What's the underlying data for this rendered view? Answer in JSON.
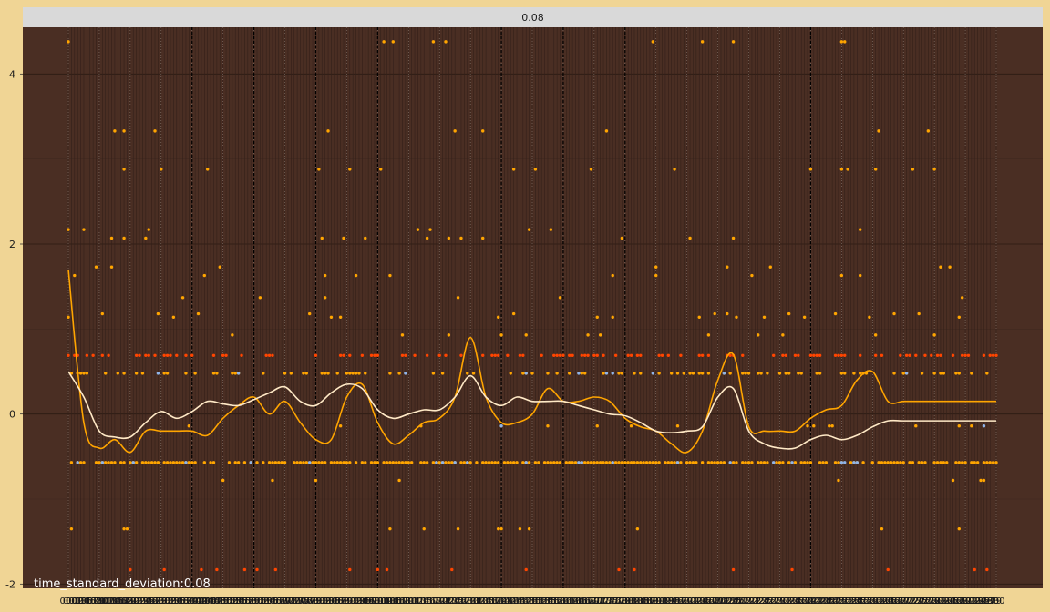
{
  "panel": {
    "strip_label": "0.08"
  },
  "caption": {
    "prefix": "time_standard_deviation:",
    "value": "0.08"
  },
  "colors": {
    "background": "#f0d595",
    "panel_bg": "#4a2e23",
    "strip_bg": "#d9d9d9",
    "points_orange": "#ffa500",
    "points_red": "#ff4500",
    "points_blue": "#8fb4e8",
    "smooth_orange": "#ffa500",
    "smooth_cream": "#ffe9c6"
  },
  "chart_data": {
    "type": "scatter",
    "title": "0.08",
    "xlabel": "",
    "ylabel": "",
    "xlim": [
      0,
      300
    ],
    "ylim": [
      -2.05,
      4.55
    ],
    "yticks": [
      -2,
      0,
      2,
      4
    ],
    "x_tick_count": 300,
    "major_vlines_x": [
      40,
      60,
      80,
      100,
      140,
      160,
      180,
      240
    ],
    "grid": true,
    "series": [
      {
        "color": "#ffa500",
        "level_values": [
          4.38,
          3.33,
          2.88,
          2.17,
          2.07,
          1.73,
          1.63,
          1.37,
          1.18,
          1.14,
          0.93,
          0.48,
          -0.14,
          -0.57,
          -0.78,
          -1.35
        ]
      },
      {
        "color": "#ff4500",
        "level_values": [
          0.69,
          -1.83
        ]
      },
      {
        "color": "#8fb4e8",
        "level_values": [
          0.48,
          -0.14,
          -0.57
        ]
      }
    ],
    "smooth_lines": [
      {
        "color": "#ffa500",
        "x": [
          0,
          5,
          10,
          15,
          20,
          25,
          30,
          35,
          40,
          45,
          50,
          55,
          60,
          65,
          70,
          75,
          80,
          85,
          90,
          95,
          100,
          105,
          110,
          115,
          120,
          125,
          130,
          135,
          140,
          145,
          150,
          155,
          160,
          165,
          170,
          175,
          180,
          185,
          190,
          195,
          200,
          205,
          210,
          215,
          220,
          225,
          230,
          235,
          240,
          245,
          250,
          255,
          260,
          265,
          270,
          275,
          280,
          285,
          290,
          295,
          300
        ],
        "y": [
          1.7,
          -0.1,
          -0.4,
          -0.3,
          -0.45,
          -0.2,
          -0.2,
          -0.2,
          -0.2,
          -0.25,
          -0.05,
          0.1,
          0.2,
          0.0,
          0.15,
          -0.1,
          -0.3,
          -0.3,
          0.2,
          0.35,
          -0.1,
          -0.35,
          -0.25,
          -0.1,
          -0.05,
          0.2,
          0.9,
          0.2,
          -0.1,
          -0.1,
          0.0,
          0.3,
          0.15,
          0.15,
          0.2,
          0.15,
          -0.05,
          -0.15,
          -0.2,
          -0.35,
          -0.45,
          -0.2,
          0.4,
          0.7,
          -0.15,
          -0.2,
          -0.2,
          -0.2,
          -0.05,
          0.05,
          0.1,
          0.4,
          0.5,
          0.15,
          0.15,
          0.15,
          0.15,
          0.15,
          0.15,
          0.15,
          0.15
        ]
      },
      {
        "color": "#ffe9c6",
        "x": [
          0,
          5,
          10,
          15,
          20,
          25,
          30,
          35,
          40,
          45,
          50,
          55,
          60,
          65,
          70,
          75,
          80,
          85,
          90,
          95,
          100,
          105,
          110,
          115,
          120,
          125,
          130,
          135,
          140,
          145,
          150,
          155,
          160,
          165,
          170,
          175,
          180,
          185,
          190,
          195,
          200,
          205,
          210,
          215,
          220,
          225,
          230,
          235,
          240,
          245,
          250,
          255,
          260,
          265,
          270,
          275,
          280,
          285,
          290,
          295,
          300
        ],
        "y": [
          0.5,
          0.2,
          -0.2,
          -0.27,
          -0.27,
          -0.1,
          0.03,
          -0.05,
          0.03,
          0.15,
          0.12,
          0.1,
          0.17,
          0.25,
          0.32,
          0.15,
          0.1,
          0.25,
          0.35,
          0.3,
          0.05,
          -0.05,
          0.0,
          0.05,
          0.05,
          0.2,
          0.45,
          0.2,
          0.1,
          0.2,
          0.15,
          0.15,
          0.15,
          0.1,
          0.05,
          0.0,
          -0.02,
          -0.1,
          -0.2,
          -0.22,
          -0.2,
          -0.15,
          0.2,
          0.3,
          -0.2,
          -0.35,
          -0.4,
          -0.4,
          -0.3,
          -0.25,
          -0.3,
          -0.25,
          -0.15,
          -0.08,
          -0.08,
          -0.08,
          -0.08,
          -0.08,
          -0.08,
          -0.08,
          -0.08
        ]
      }
    ]
  }
}
